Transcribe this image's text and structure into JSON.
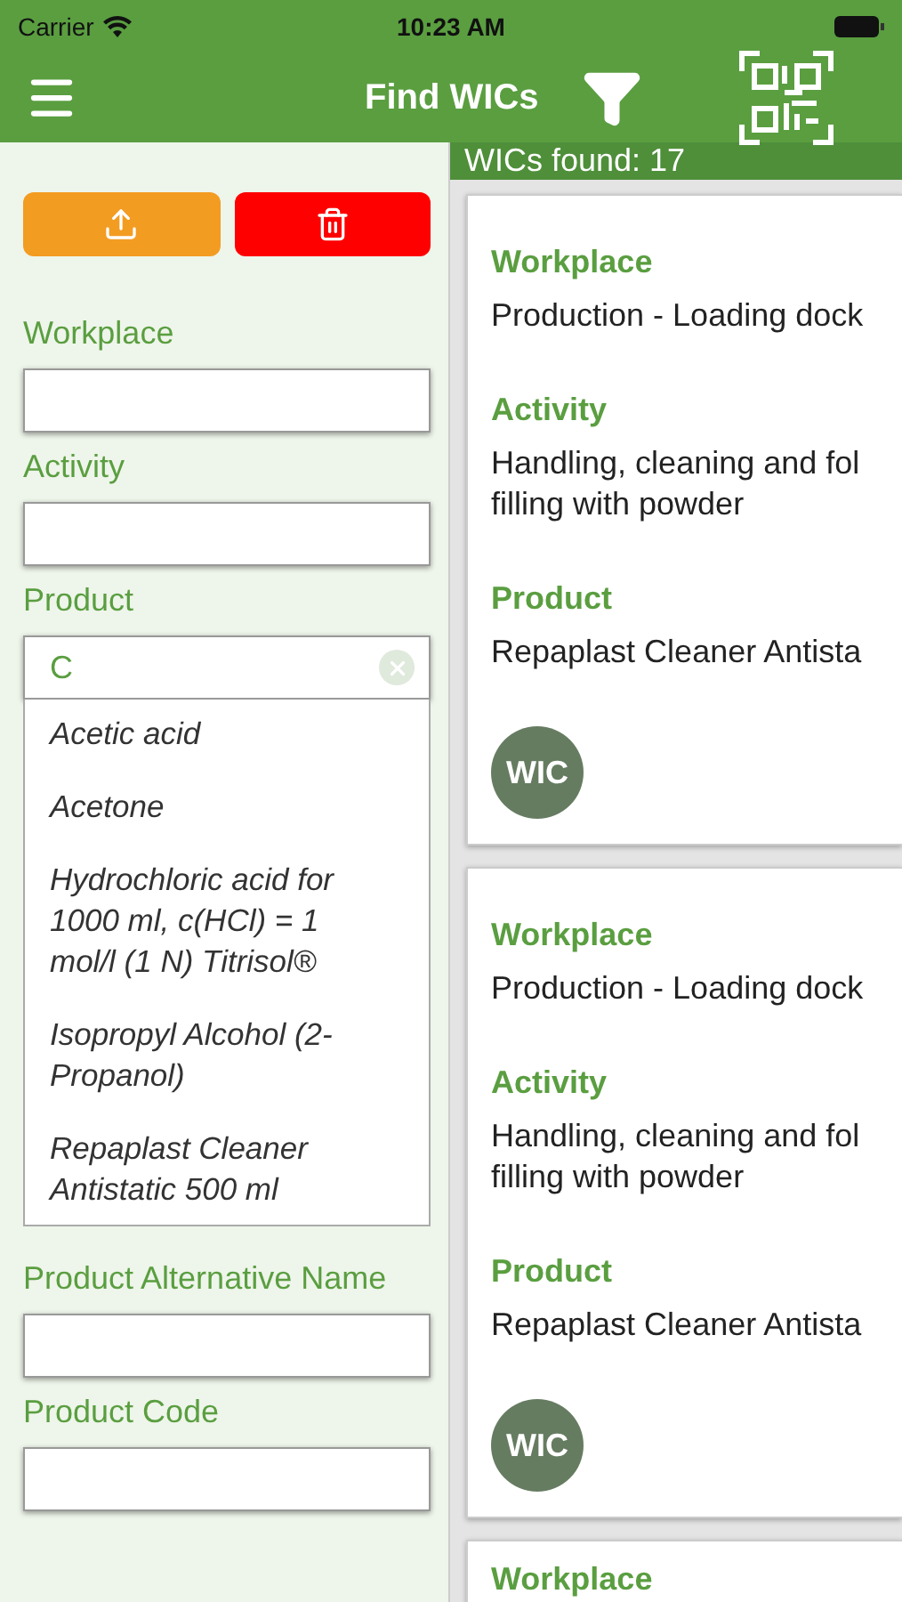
{
  "status_bar": {
    "carrier": "Carrier",
    "time": "10:23 AM"
  },
  "header": {
    "title": "Find WICs"
  },
  "filters": [
    {
      "label": "Workplace"
    },
    {
      "label": "Activity"
    },
    {
      "label": "Product",
      "value": "C",
      "suggestions": [
        "Acetic acid",
        "Acetone",
        "Hydrochloric acid for 1000 ml, c(HCl) = 1 mol/l (1 N) Titrisol®",
        "Isopropyl Alcohol (2-Propanol)",
        "Repaplast Cleaner Antistatic 500 ml"
      ]
    },
    {
      "label": "Product Alternative Name"
    },
    {
      "label": "Product Code"
    }
  ],
  "results": {
    "count_label": "WICs found: 17",
    "cards": [
      {
        "fields": [
          {
            "label": "Workplace",
            "value": "Production - Loading dock"
          },
          {
            "label": "Activity",
            "value": "Handling, cleaning and fol\nfilling with powder"
          },
          {
            "label": "Product",
            "value": "Repaplast Cleaner Antista"
          }
        ],
        "badge": "WIC"
      },
      {
        "fields": [
          {
            "label": "Workplace",
            "value": "Production - Loading dock"
          },
          {
            "label": "Activity",
            "value": "Handling, cleaning and fol\nfilling with powder"
          },
          {
            "label": "Product",
            "value": "Repaplast Cleaner Antista"
          }
        ],
        "badge": "WIC"
      },
      {
        "fields": [
          {
            "label": "Workplace"
          }
        ]
      }
    ]
  }
}
